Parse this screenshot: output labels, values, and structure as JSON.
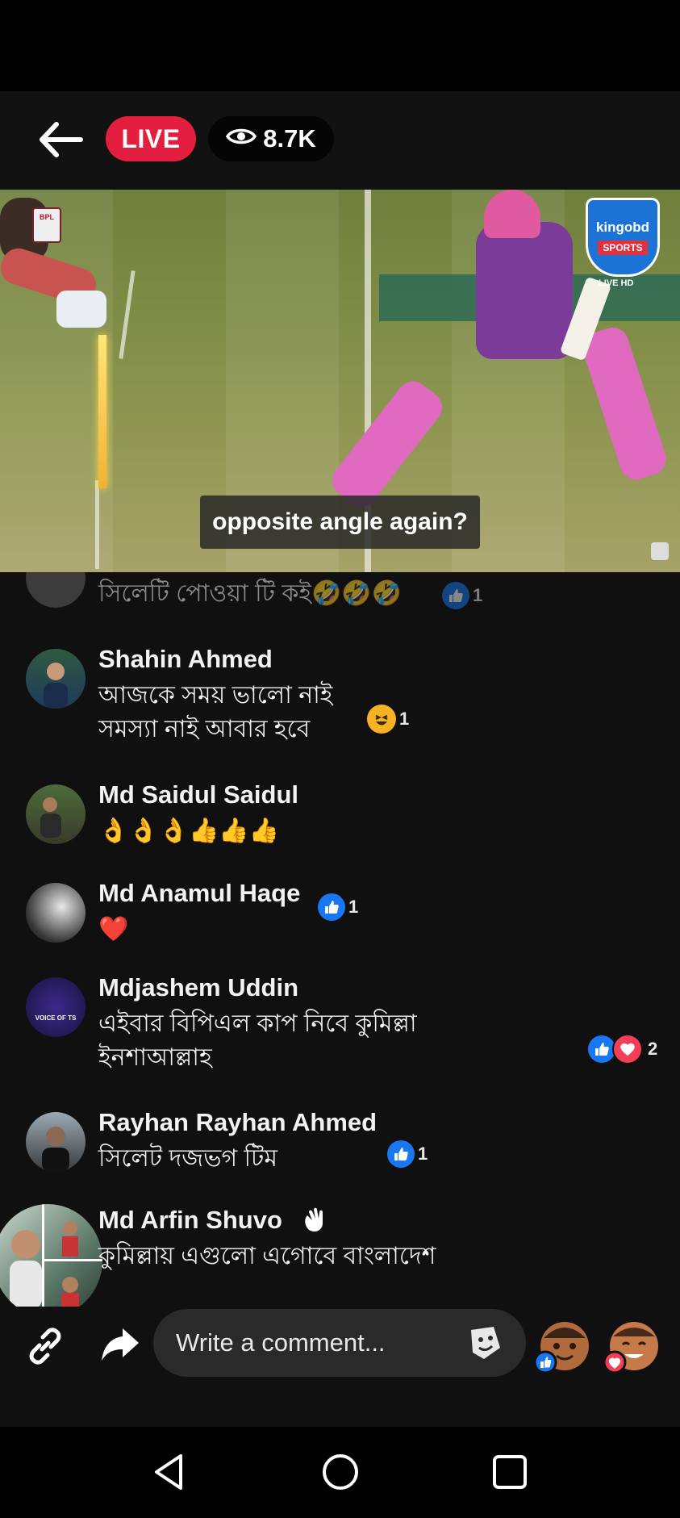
{
  "header": {
    "live_label": "LIVE",
    "viewer_count": "8.7K",
    "icons": {
      "back": "back-arrow-icon",
      "viewers": "eye-icon"
    }
  },
  "video": {
    "caption": "opposite angle again?",
    "overlays": {
      "top_left_logo": "BPL",
      "brand_name": "kingobd",
      "brand_sub": "SPORTS",
      "brand_tag": "LIVE HD"
    }
  },
  "comments": [
    {
      "name": "",
      "text": "সিলেটি পোওয়া টি কই🤣🤣🤣",
      "reaction_count": "1",
      "reaction_type": "like"
    },
    {
      "name": "Shahin Ahmed",
      "text_lines": [
        "আজকে সময় ভালো নাই",
        "সমস্যা নাই আবার হবে"
      ],
      "reaction_count": "1",
      "reaction_type": "laugh"
    },
    {
      "name": "Md Saidul Saidul",
      "text": "👌👌👌👍👍👍"
    },
    {
      "name": "Md Anamul Haqe",
      "text": "❤️",
      "reaction_count": "1",
      "reaction_type": "like"
    },
    {
      "name": "Mdjashem Uddin",
      "text_lines": [
        "এইবার বিপিএল কাপ নিবে কুমিল্লা",
        "ইনশাআল্লাহ"
      ],
      "reaction_count": "2",
      "reaction_type": "like+love",
      "avatar_text": "VOICE OF TS"
    },
    {
      "name": "Rayhan Rayhan Ahmed",
      "text": "সিলেট দজভগ টিম",
      "reaction_count": "1",
      "reaction_type": "like"
    },
    {
      "name": "Md Arfin Shuvo",
      "text": "কুমিল্লায় এগুলো এগোবে বাংলাদেশ",
      "badge": "waving-hand-icon"
    }
  ],
  "composer": {
    "placeholder": "Write a comment...",
    "icons": [
      "link-icon",
      "share-icon",
      "sticker-icon",
      "like-reaction-face-icon",
      "love-reaction-face-icon"
    ]
  },
  "navigation": {
    "icons": [
      "back-triangle-icon",
      "home-circle-icon",
      "recents-square-icon"
    ]
  },
  "colors": {
    "live_red": "#e41e3f",
    "like_blue": "#1877f2",
    "love_red": "#f33e58",
    "background": "#101010"
  }
}
